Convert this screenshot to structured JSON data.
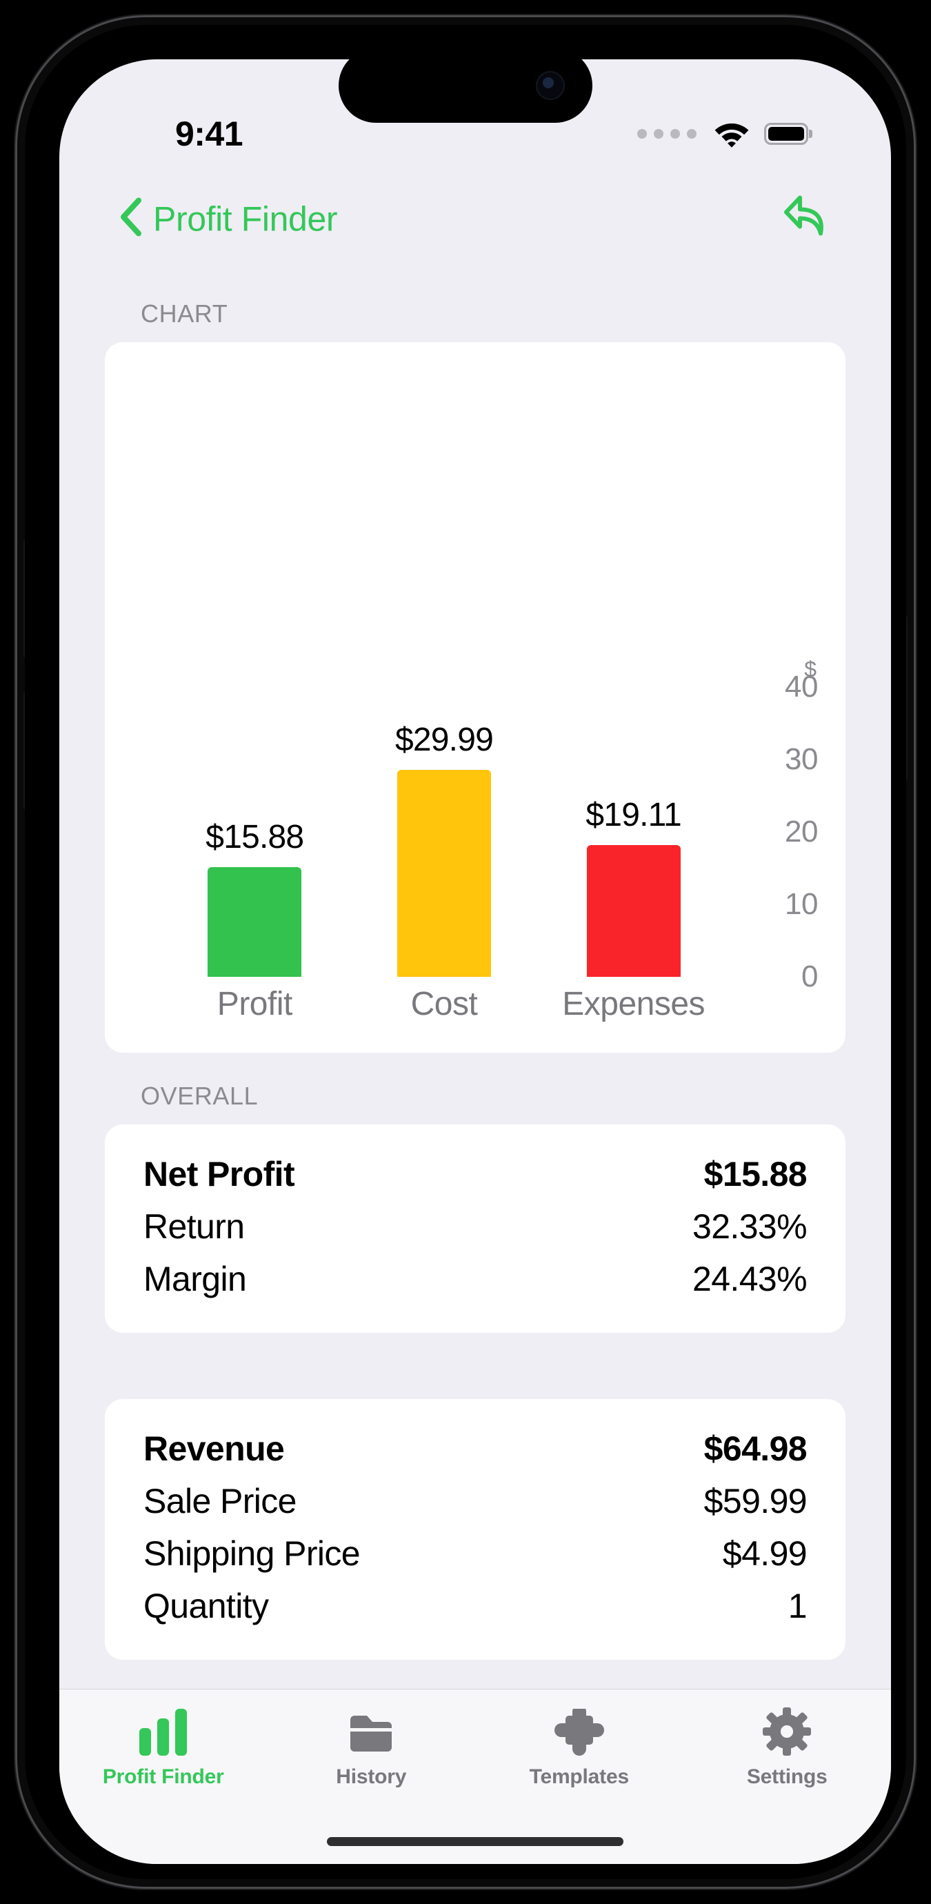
{
  "status_bar": {
    "time": "9:41",
    "signal_icon": "signal-dots-icon",
    "wifi_icon": "wifi-icon",
    "battery_icon": "battery-icon"
  },
  "nav_bar": {
    "back_label": "Profit Finder",
    "back_icon": "chevron-left-icon",
    "undo_icon": "undo-arrow-icon",
    "accent_color": "#34c759"
  },
  "sections": {
    "chart_header": "CHART",
    "overall_header": "OVERALL"
  },
  "chart_data": {
    "type": "bar",
    "title": "CHART",
    "categories": [
      "Profit",
      "Cost",
      "Expenses"
    ],
    "values": [
      15.88,
      29.99,
      19.11
    ],
    "value_labels": [
      "$15.88",
      "$29.99",
      "$19.11"
    ],
    "colors": [
      "#32c24d",
      "#ffc40c",
      "#f92429"
    ],
    "xlabel": "",
    "ylabel": "$",
    "ylim": [
      0,
      40
    ],
    "yticks": [
      40,
      30,
      20,
      10,
      0
    ],
    "ytick_labels": [
      "40",
      "30",
      "20",
      "10",
      "0"
    ],
    "currency_symbol": "$",
    "grid": false,
    "legend": false
  },
  "overall": {
    "rows": [
      {
        "label": "Net Profit",
        "value": "$15.88",
        "primary": true
      },
      {
        "label": "Return",
        "value": "32.33%",
        "primary": false
      },
      {
        "label": "Margin",
        "value": "24.43%",
        "primary": false
      }
    ]
  },
  "revenue": {
    "rows": [
      {
        "label": "Revenue",
        "value": "$64.98",
        "primary": true
      },
      {
        "label": "Sale Price",
        "value": "$59.99",
        "primary": false
      },
      {
        "label": "Shipping Price",
        "value": "$4.99",
        "primary": false
      },
      {
        "label": "Quantity",
        "value": "1",
        "primary": false
      }
    ]
  },
  "tab_bar": {
    "items": [
      {
        "label": "Profit Finder",
        "icon": "bar-chart-icon",
        "active": true
      },
      {
        "label": "History",
        "icon": "folder-icon",
        "active": false
      },
      {
        "label": "Templates",
        "icon": "puzzle-piece-icon",
        "active": false
      },
      {
        "label": "Settings",
        "icon": "gear-icon",
        "active": false
      }
    ]
  }
}
